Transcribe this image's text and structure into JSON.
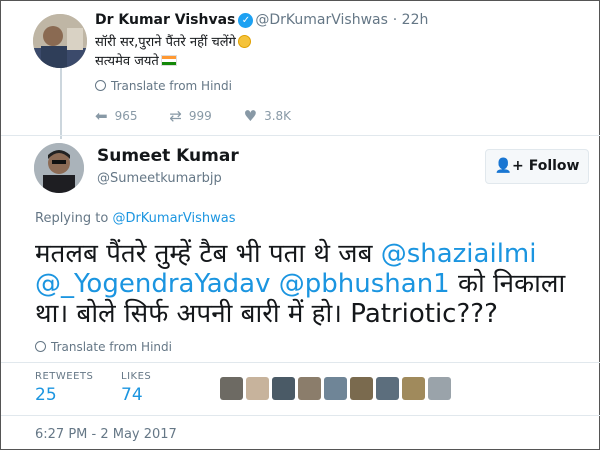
{
  "parent_tweet": {
    "name": "Dr Kumar Vishvas",
    "handle": "@DrKumarVishwas",
    "time": "· 22h",
    "text_line1": "सॉरी सर,पुराने पैंतरे नहीं चलेंगे",
    "text_line2": "सत्यमेव जयते",
    "translate_label": "Translate from Hindi",
    "replies": "965",
    "retweets": "999",
    "likes": "3.8K"
  },
  "main_tweet": {
    "name": "Sumeet Kumar",
    "handle": "@Sumeetkumarbjp",
    "follow_label": "Follow",
    "replying_prefix": "Replying to",
    "replying_to": "@DrKumarVishwas",
    "text": {
      "line1_a": "मतलब पैंतरे तुम्हें टैब भी पता थे जब ",
      "line1_mention": "@shaziailmi",
      "line2_mention1": "@_YogendraYadav",
      "line2_mention2": "@pbhushan1",
      "line2_b": " को निकाला",
      "line3": "था। बोले सिर्फ अपनी बारी में हो। Patriotic???"
    },
    "translate_label": "Translate from Hindi",
    "retweets_label": "RETWEETS",
    "retweets_count": "25",
    "likes_label": "LIKES",
    "likes_count": "74",
    "timestamp": "6:27 PM - 2 May 2017"
  },
  "icons": {
    "verified": "verified-badge-icon",
    "reply": "reply-icon",
    "retweet": "retweet-icon",
    "like": "heart-icon",
    "globe": "globe-icon",
    "follow": "add-user-icon"
  },
  "colors": {
    "link": "#1b95e0",
    "verified": "#1da1f2",
    "muted": "#657786"
  }
}
